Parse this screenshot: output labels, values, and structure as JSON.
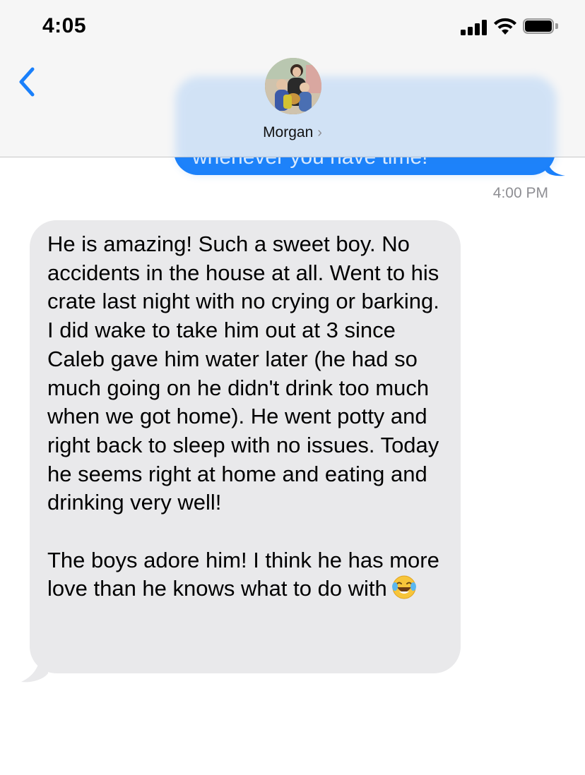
{
  "status_bar": {
    "time": "4:05"
  },
  "header": {
    "contact_name": "Morgan",
    "chevron": "›"
  },
  "messages": [
    {
      "direction": "outgoing",
      "visible_text": "whenever you have time!"
    },
    {
      "direction": "timestamp",
      "text": "4:00 PM"
    },
    {
      "direction": "incoming",
      "text": "He is amazing! Such a sweet boy. No accidents in the house at all. Went to his crate last night with no crying or barking. I did wake to take him out at 3 since Caleb gave him water later (he had so much going on he didn't drink too much when we got home). He went potty and right back to sleep with no issues. Today he seems right at home and eating and drinking very well!\n\nThe boys adore him! I think he has more love than he knows what to do with",
      "emoji": "face-with-tears-of-joy"
    }
  ],
  "colors": {
    "accent_blue": "#1a80fb",
    "incoming_bubble": "#e9e9eb",
    "secondary_text": "#8e8e93"
  }
}
